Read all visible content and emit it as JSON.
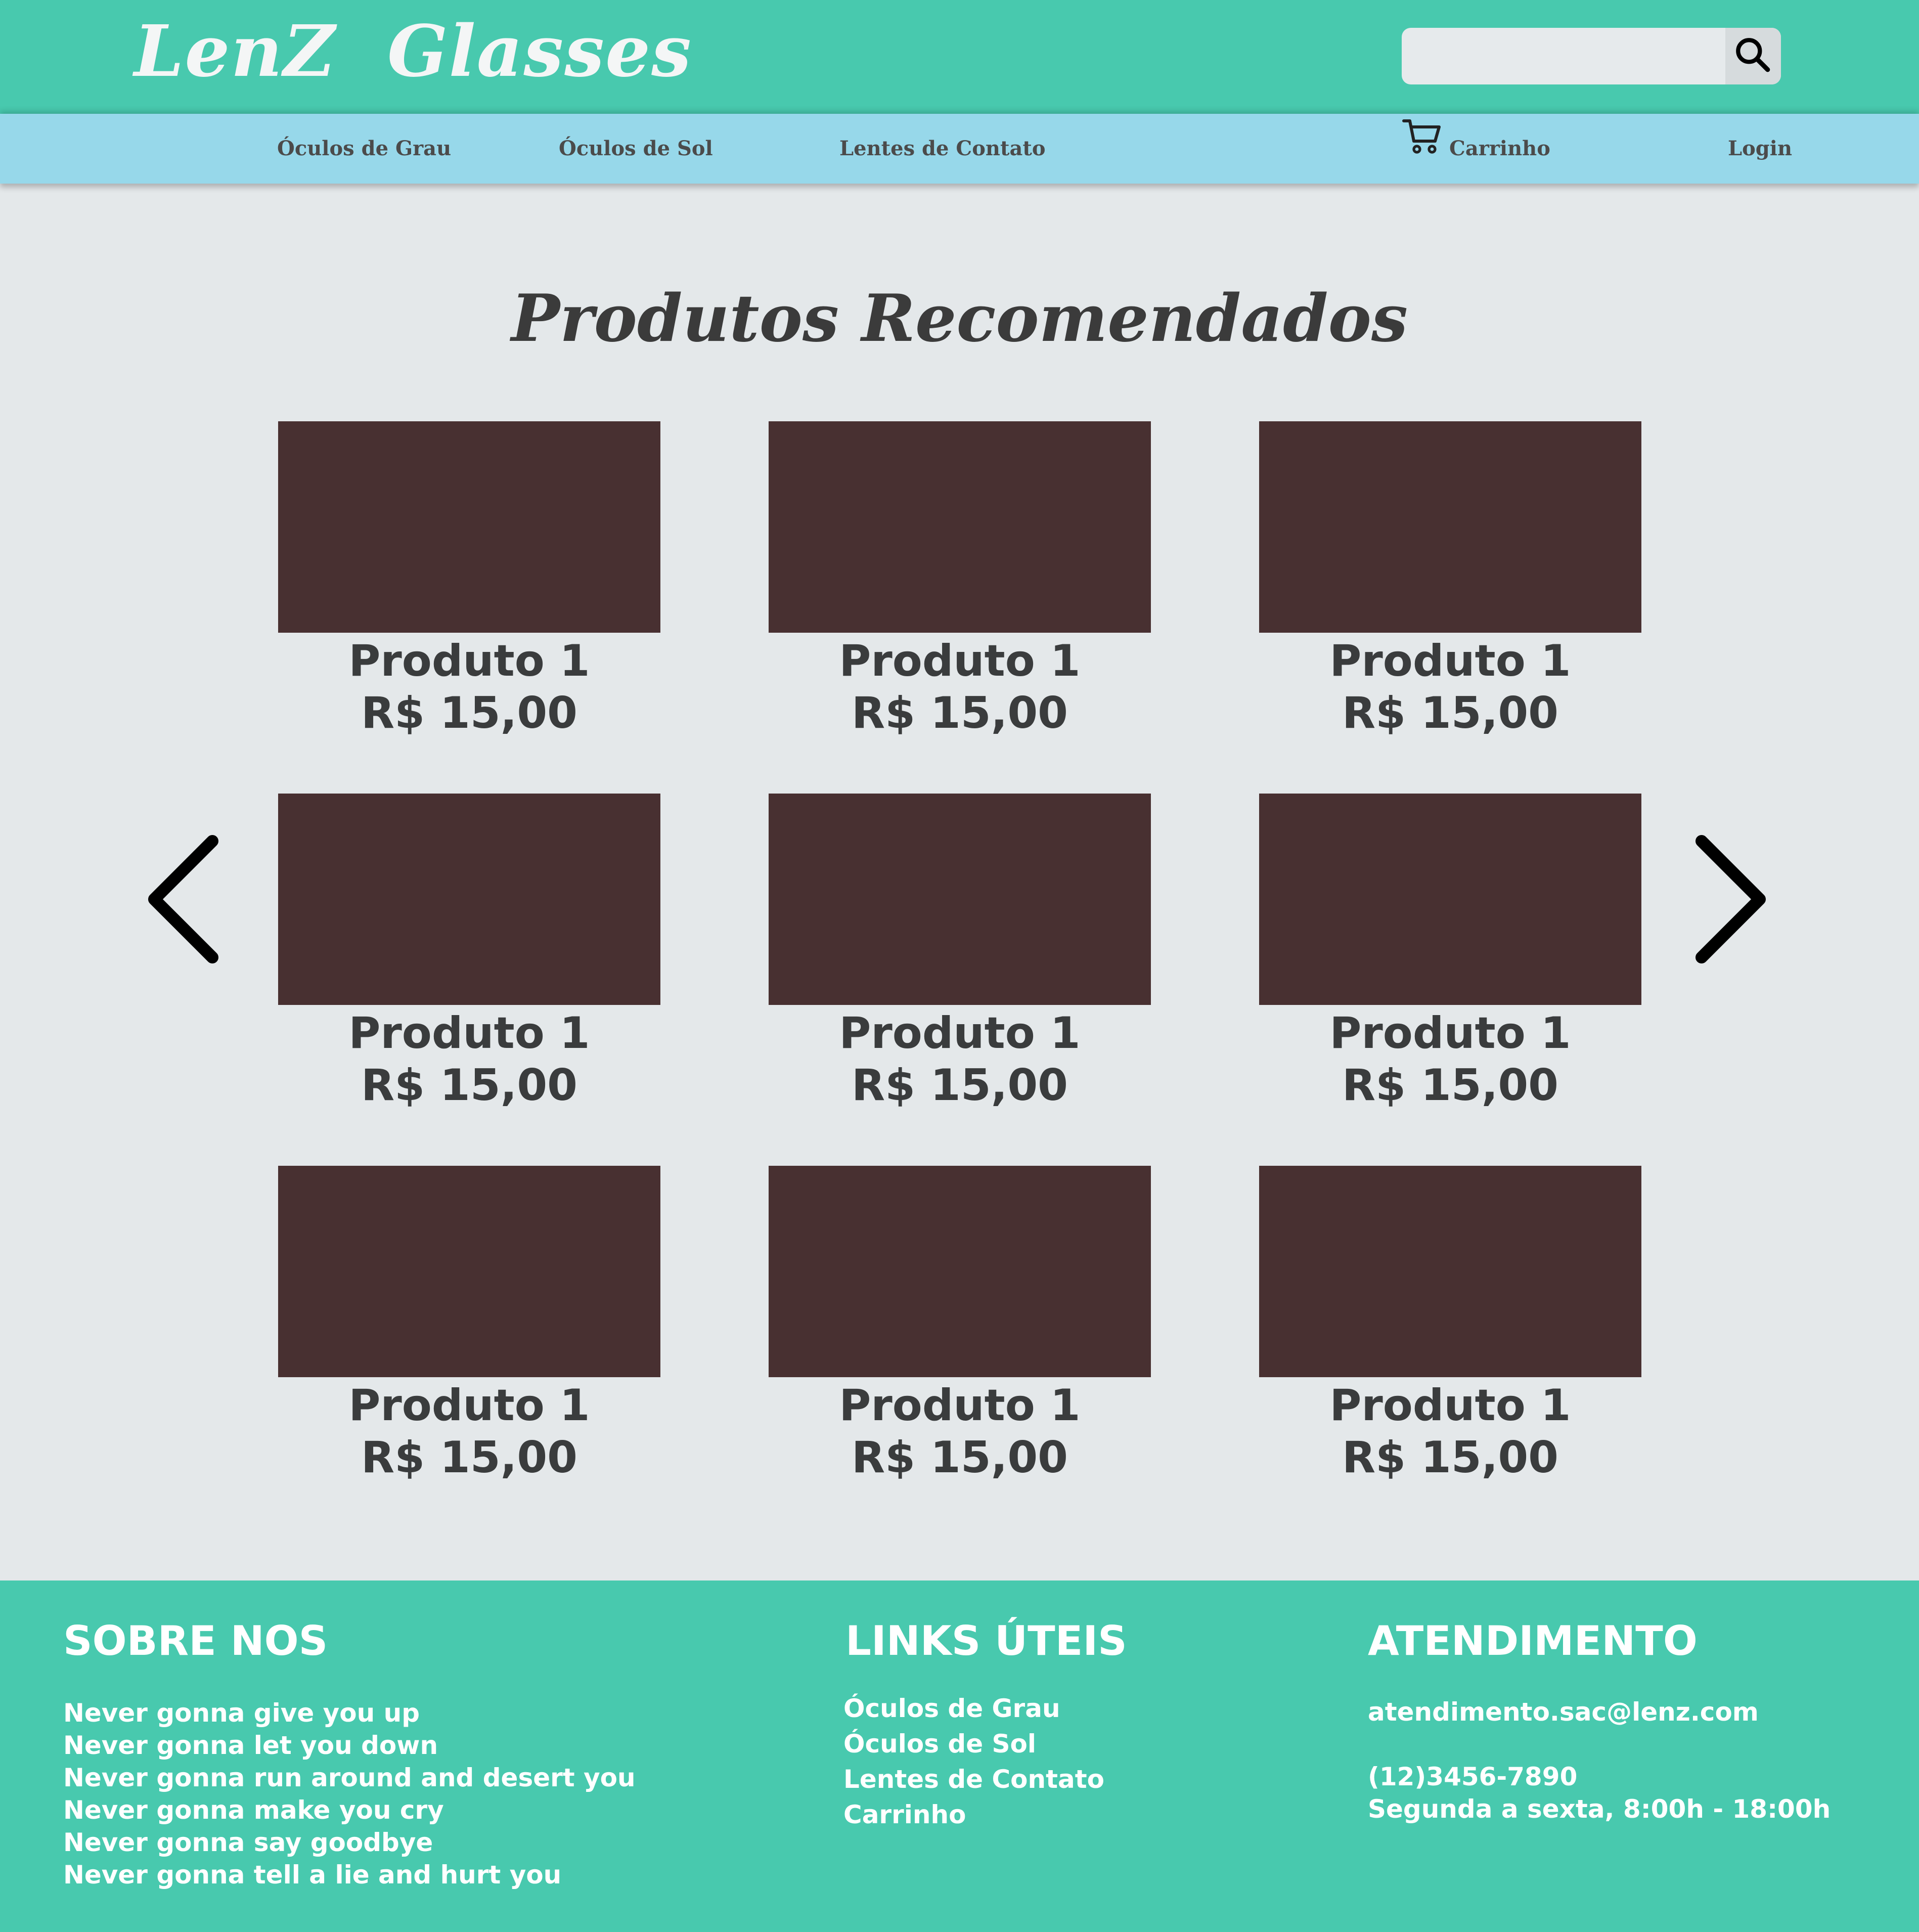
{
  "header": {
    "logo": "LenZ  Glasses",
    "search_placeholder": ""
  },
  "nav": {
    "oculos_grau": "Óculos de Grau",
    "oculos_sol": "Óculos de Sol",
    "lentes": "Lentes de Contato",
    "carrinho": "Carrinho",
    "login": "Login"
  },
  "main": {
    "title": "Produtos Recomendados",
    "products": [
      {
        "name": "Produto 1",
        "price": "R$ 15,00"
      },
      {
        "name": "Produto 1",
        "price": "R$ 15,00"
      },
      {
        "name": "Produto 1",
        "price": "R$ 15,00"
      },
      {
        "name": "Produto 1",
        "price": "R$ 15,00"
      },
      {
        "name": "Produto 1",
        "price": "R$ 15,00"
      },
      {
        "name": "Produto 1",
        "price": "R$ 15,00"
      },
      {
        "name": "Produto 1",
        "price": "R$ 15,00"
      },
      {
        "name": "Produto 1",
        "price": "R$ 15,00"
      },
      {
        "name": "Produto 1",
        "price": "R$ 15,00"
      }
    ]
  },
  "footer": {
    "sobre": {
      "title": "SOBRE NOS",
      "lines": [
        "Never gonna give you up",
        "Never gonna let you down",
        "Never gonna run around and desert you",
        "Never gonna make you cry",
        "Never gonna say goodbye",
        "Never gonna tell a lie and hurt you"
      ]
    },
    "links": {
      "title": "LINKS ÚTEIS",
      "items": [
        "Óculos de Grau",
        "Óculos de Sol",
        "Lentes de Contato",
        "Carrinho"
      ]
    },
    "atendimento": {
      "title": "ATENDIMENTO",
      "email": "atendimento.sac@lenz.com",
      "phone": "(12)3456-7890",
      "hours": "Segunda a sexta, 8:00h - 18:00h"
    }
  },
  "colors": {
    "header_bg": "#48c9ae",
    "nav_bg": "#97d8ea",
    "page_bg": "#e4e8ea",
    "product_placeholder": "#483031",
    "footer_bg": "#48c9ae"
  },
  "icons": {
    "search": "search-icon",
    "cart": "cart-icon",
    "prev": "chevron-left-icon",
    "next": "chevron-right-icon"
  }
}
